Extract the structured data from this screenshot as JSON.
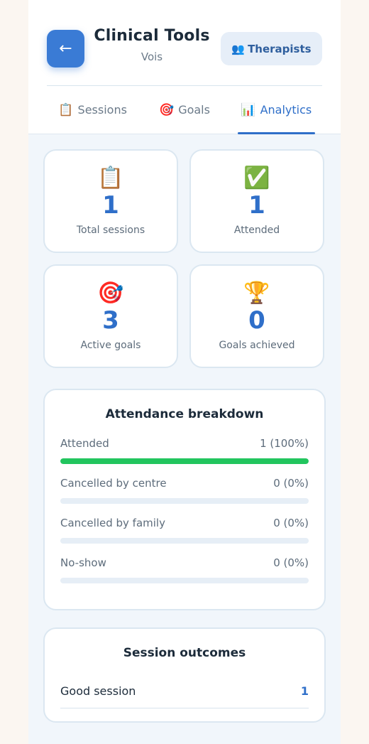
{
  "header": {
    "back_icon": "←",
    "title": "Clinical Tools",
    "subtitle": "Vois",
    "therapists_icon": "👥",
    "therapists_label": "Therapists"
  },
  "tabs": [
    {
      "icon": "📋",
      "label": "Sessions",
      "active": false
    },
    {
      "icon": "🎯",
      "label": "Goals",
      "active": false
    },
    {
      "icon": "📊",
      "label": "Analytics",
      "active": true
    }
  ],
  "stats": [
    {
      "icon": "📋",
      "value": "1",
      "label": "Total sessions"
    },
    {
      "icon": "✅",
      "value": "1",
      "label": "Attended"
    },
    {
      "icon": "🎯",
      "value": "3",
      "label": "Active goals"
    },
    {
      "icon": "🏆",
      "value": "0",
      "label": "Goals achieved"
    }
  ],
  "attendance": {
    "title": "Attendance breakdown",
    "items": [
      {
        "label": "Attended",
        "value": "1 (100%)",
        "fraction": 1.0
      },
      {
        "label": "Cancelled by centre",
        "value": "0 (0%)",
        "fraction": 0
      },
      {
        "label": "Cancelled by family",
        "value": "0 (0%)",
        "fraction": 0
      },
      {
        "label": "No-show",
        "value": "0 (0%)",
        "fraction": 0
      }
    ]
  },
  "outcomes": {
    "title": "Session outcomes",
    "items": [
      {
        "label": "Good session",
        "count": "1"
      }
    ]
  },
  "colors": {
    "accent": "#2f6fc9",
    "progress": "#22c55e",
    "background": "#f1f6fb"
  }
}
